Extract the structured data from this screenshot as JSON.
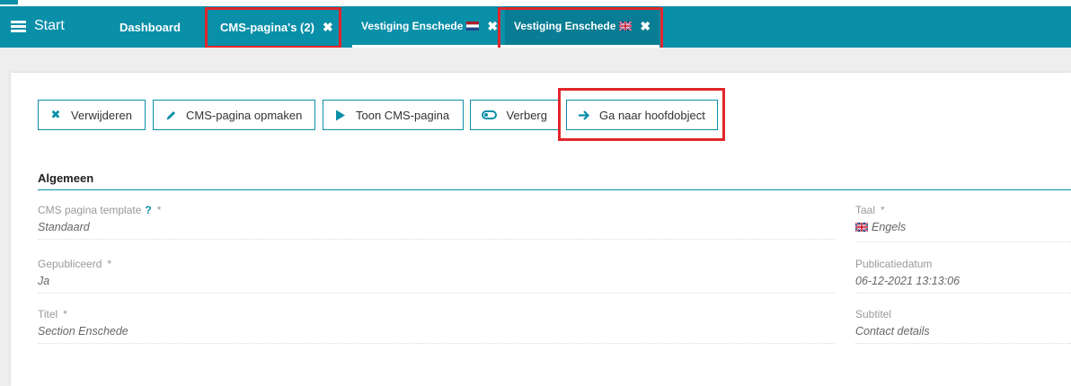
{
  "nav": {
    "start_label": "Start",
    "tabs": [
      {
        "label": "Dashboard"
      },
      {
        "label": "CMS-pagina's (2)",
        "close": "✖"
      },
      {
        "label": "Vestiging Enschede",
        "close": "✖",
        "flag": "nl"
      },
      {
        "label": "Vestiging Enschede",
        "close": "✖",
        "flag": "en"
      }
    ]
  },
  "toolbar": {
    "delete_label": "Verwijderen",
    "edit_label": "CMS-pagina opmaken",
    "show_label": "Toon CMS-pagina",
    "hide_label": "Verberg",
    "goto_label": "Ga naar hoofdobject"
  },
  "section": {
    "title": "Algemeen",
    "fields": [
      {
        "label": "CMS pagina template",
        "help": "?",
        "required": "*",
        "value": "Standaard"
      },
      {
        "label": "Gepubliceerd",
        "required": "*",
        "value": "Ja"
      },
      {
        "label": "Titel",
        "required": "*",
        "value": "Section Enschede"
      },
      {
        "label": "Taal",
        "required": "*",
        "value": "Engels"
      },
      {
        "label": "Publicatiedatum",
        "value": "06-12-2021 13:13:06"
      },
      {
        "label": "Subtitel",
        "value": "Contact details"
      }
    ]
  },
  "colors": {
    "brand": "#0a8fa8",
    "highlight": "#e0262b"
  }
}
